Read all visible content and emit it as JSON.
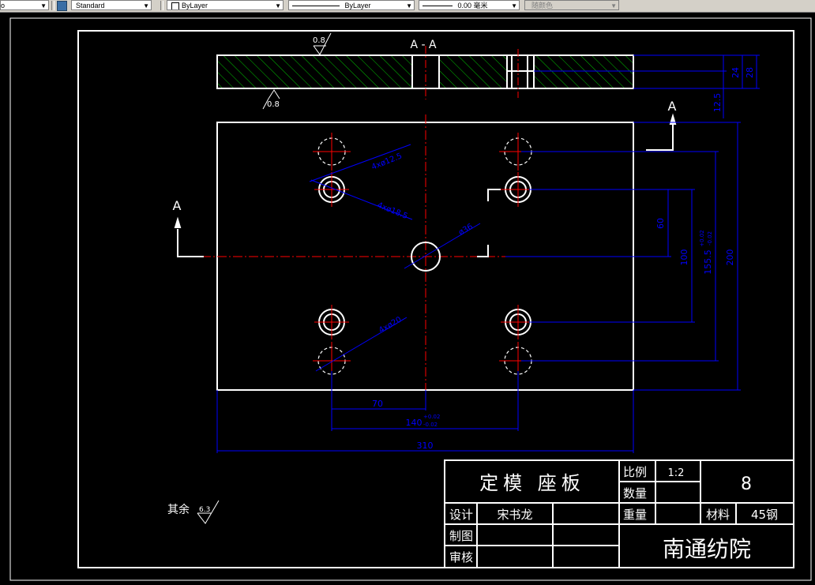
{
  "toolbar": {
    "first_value": "o",
    "text_style": "Standard",
    "layer": "ByLayer",
    "linetype": "ByLayer",
    "lineweight": "0.00 毫米",
    "color": "随颜色"
  },
  "drawing": {
    "section_label": "A - A",
    "section_mark": "A",
    "roughness_top": "0.8",
    "roughness_bottom": "0.8",
    "roughness_other": "6.3",
    "other_note": "其余",
    "dims": {
      "d12_5": "12.5",
      "d24": "24",
      "d28": "28",
      "holes_12_5": "4xø12.5",
      "holes_18_5": "4xø18.5",
      "hole_36": "ø36",
      "pins_20": "4xø20",
      "d60": "60",
      "d100": "100",
      "d155_5": "155.5",
      "d155_5_tol_up": "+0.02",
      "d155_5_tol_dn": "-0.02",
      "d200": "200",
      "d70": "70",
      "d140": "140",
      "d140_tol_up": "+0.02",
      "d140_tol_dn": "-0.02",
      "d310": "310"
    }
  },
  "title_block": {
    "title": "定模 座板",
    "scale_label": "比例",
    "scale_value": "1:2",
    "quantity_label": "数量",
    "sheet_number": "8",
    "weight_label": "重量",
    "material_label": "材料",
    "material_value": "45钢",
    "design_label": "设计",
    "designer": "宋书龙",
    "drawn_label": "制图",
    "check_label": "审核",
    "company": "南通纺院"
  },
  "colors": {
    "border": "#ffffff",
    "dimension": "#0000ff",
    "centerline": "#ff0000",
    "hatch": "#00c000",
    "hidden_holes": "#ffff00"
  }
}
